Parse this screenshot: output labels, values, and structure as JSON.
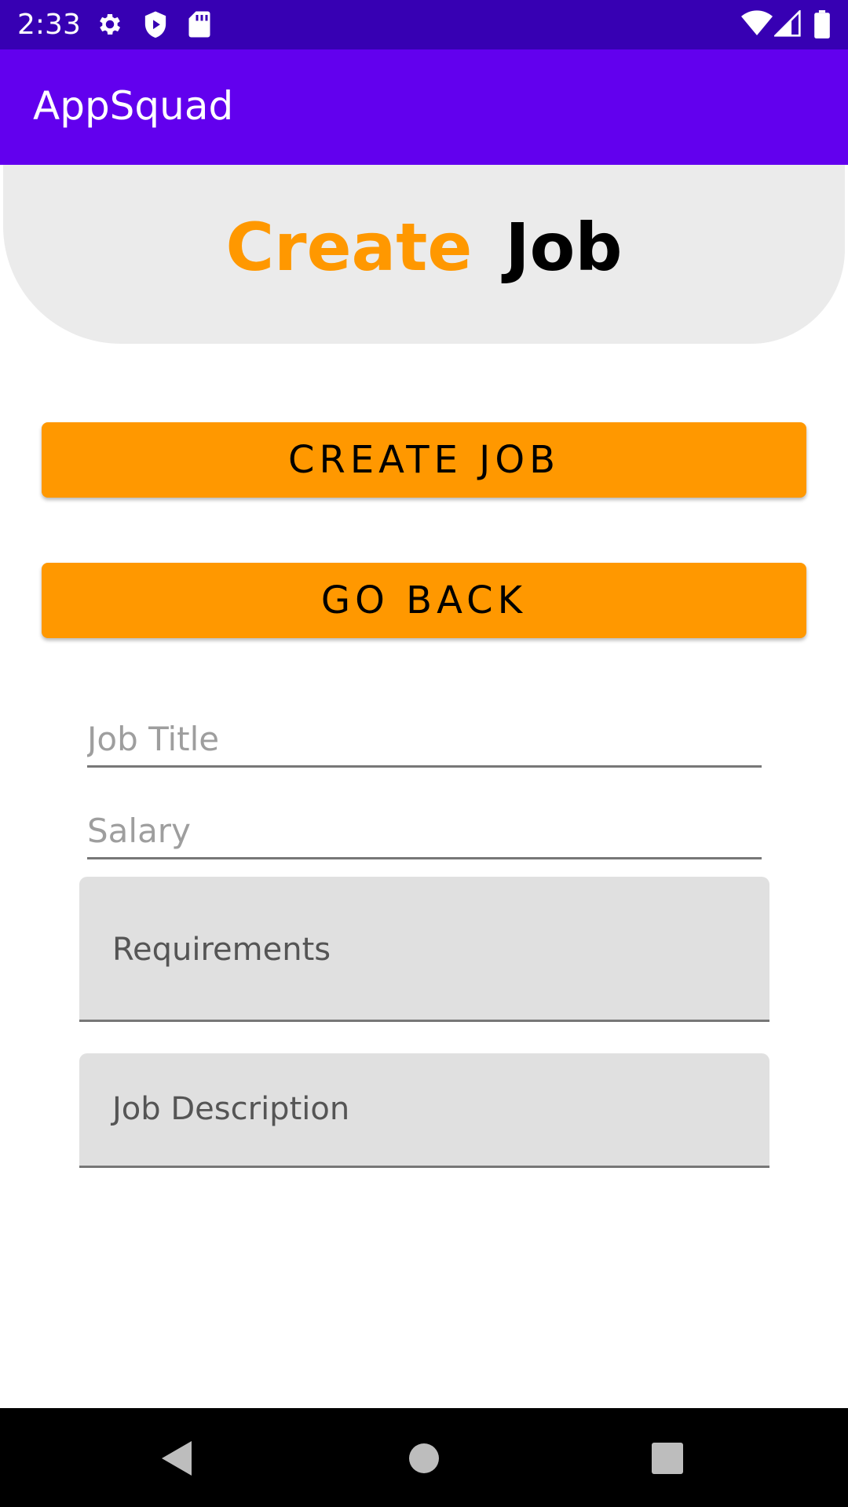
{
  "status_bar": {
    "time": "2:33",
    "icons": [
      "gear-icon",
      "shield-play-icon",
      "sd-card-icon",
      "wifi-icon",
      "signal-icon",
      "battery-icon"
    ]
  },
  "app_bar": {
    "title": "AppSquad"
  },
  "header": {
    "word1": "Create",
    "word2": "Job"
  },
  "buttons": {
    "create": "CREATE JOB",
    "back": "GO BACK"
  },
  "form": {
    "job_title_placeholder": "Job Title",
    "salary_placeholder": "Salary",
    "requirements_label": "Requirements",
    "description_label": "Job Description"
  },
  "nav_bar": {
    "icons": [
      "back-triangle-icon",
      "home-circle-icon",
      "recents-square-icon"
    ]
  },
  "colors": {
    "status_bar": "#3700B3",
    "app_bar": "#6200EE",
    "accent": "#FF9800",
    "header_bg": "#EBEBEB",
    "field_bg": "#E0E0E0"
  }
}
